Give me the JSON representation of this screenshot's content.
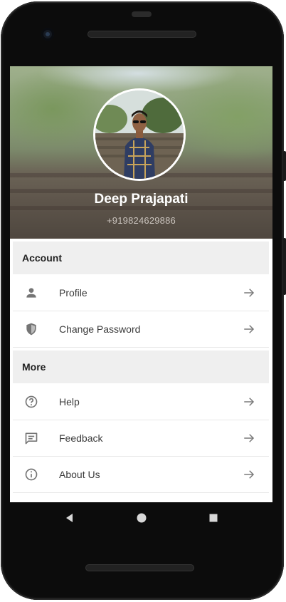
{
  "profile": {
    "name": "Deep Prajapati",
    "phone": "+919824629886"
  },
  "sections": [
    {
      "title": "Account",
      "items": [
        {
          "label": "Profile",
          "icon": "person-icon"
        },
        {
          "label": "Change Password",
          "icon": "shield-icon"
        }
      ]
    },
    {
      "title": "More",
      "items": [
        {
          "label": "Help",
          "icon": "help-circle-icon"
        },
        {
          "label": "Feedback",
          "icon": "feedback-icon"
        },
        {
          "label": "About Us",
          "icon": "info-icon"
        }
      ]
    }
  ],
  "colors": {
    "section_bg": "#efefef",
    "icon": "#757575",
    "arrow": "#7a7a7a"
  }
}
